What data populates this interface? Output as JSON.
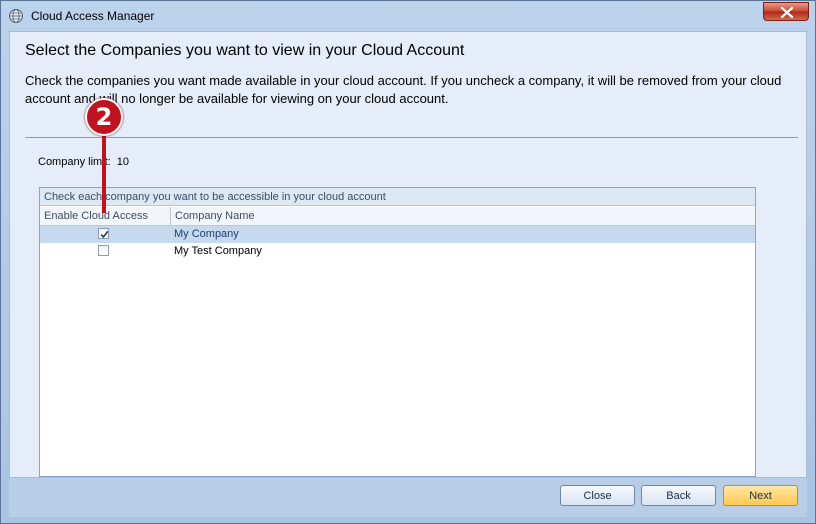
{
  "window": {
    "title": "Cloud Access Manager"
  },
  "dialog": {
    "heading": "Select the Companies you want to view in your Cloud Account",
    "description": "Check the companies you want made available in your cloud account. If you uncheck a company, it will be removed from your cloud account and will no longer be available for viewing on your cloud account.",
    "company_limit_label": "Company limit:",
    "company_limit_value": "10"
  },
  "grid": {
    "caption": "Check each company you want to be accessible in your cloud account",
    "columns": [
      "Enable Cloud Access",
      "Company Name"
    ],
    "rows": [
      {
        "enabled": true,
        "company_name": "My Company"
      },
      {
        "enabled": false,
        "company_name": "My Test Company"
      }
    ]
  },
  "buttons": {
    "close": "Close",
    "back": "Back",
    "next": "Next"
  },
  "annotation": {
    "label": "2",
    "color": "#c0121f"
  },
  "icons": {
    "app": "globe-icon",
    "close": "close-icon",
    "check": "checkmark-icon"
  }
}
